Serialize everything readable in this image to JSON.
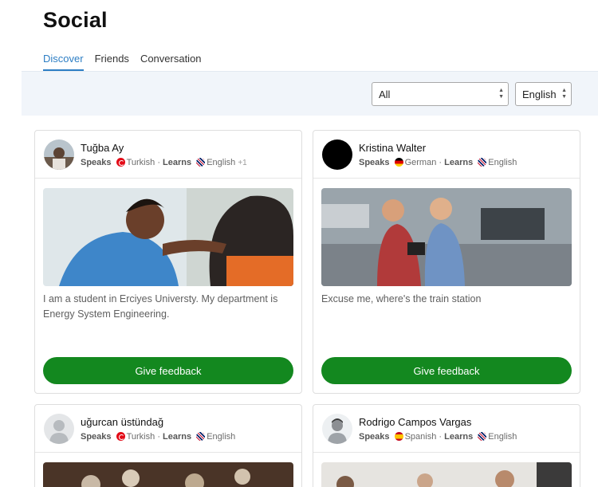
{
  "page": {
    "title": "Social"
  },
  "tabs": [
    {
      "label": "Discover",
      "active": true
    },
    {
      "label": "Friends",
      "active": false
    },
    {
      "label": "Conversation",
      "active": false
    }
  ],
  "filters": {
    "category": {
      "value": "All"
    },
    "language": {
      "value": "English"
    }
  },
  "labels": {
    "speaks": "Speaks",
    "learns": "Learns",
    "separator": "·",
    "feedback_button": "Give feedback"
  },
  "cards": [
    {
      "name": "Tuğba Ay",
      "speaks": "Turkish",
      "learns": "English",
      "extra": "+1",
      "text": "I am a student in Erciyes Universty. My department is Energy System Engineering."
    },
    {
      "name": "Kristina Walter",
      "speaks": "German",
      "learns": "English",
      "text": "Excuse me, where's the train station"
    },
    {
      "name": "uğurcan üstündağ",
      "speaks": "Turkish",
      "learns": "English"
    },
    {
      "name": "Rodrigo Campos Vargas",
      "speaks": "Spanish",
      "learns": "English"
    }
  ],
  "colors": {
    "accent": "#2d7ec4",
    "button": "#13881f",
    "filter_bar": "#f1f5fa"
  }
}
